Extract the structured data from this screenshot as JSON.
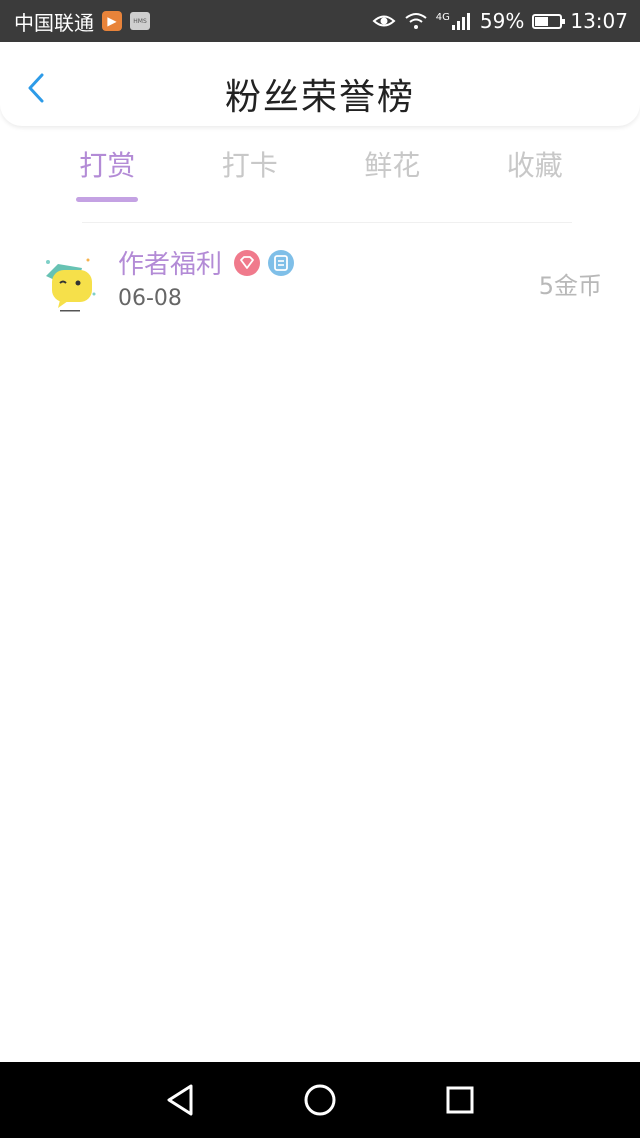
{
  "status_bar": {
    "carrier": "中国联通",
    "network": "4G",
    "battery_percent": "59%",
    "battery_level": 0.59,
    "time": "13:07",
    "icons": [
      "app-notification-icon",
      "hms-icon",
      "eye-icon",
      "wifi-icon",
      "signal-icon",
      "battery-icon"
    ]
  },
  "header": {
    "title": "粉丝荣誉榜",
    "back_icon": "chevron-left-icon"
  },
  "tabs": [
    {
      "label": "打赏",
      "active": true
    },
    {
      "label": "打卡",
      "active": false
    },
    {
      "label": "鲜花",
      "active": false
    },
    {
      "label": "收藏",
      "active": false
    }
  ],
  "list": [
    {
      "name": "作者福利",
      "date": "06-08",
      "amount": "5金币",
      "badges": [
        "heart-badge-icon",
        "doc-badge-icon"
      ],
      "avatar": "emoji-avatar-icon"
    }
  ],
  "colors": {
    "accent": "#b38bd6",
    "tab_inactive": "#c8c8c8",
    "back_arrow": "#2d9be8",
    "status_bar": "#3b3b3b",
    "nav_bar": "#000000"
  },
  "nav_bar": {
    "buttons": [
      "back-triangle-icon",
      "home-circle-icon",
      "recents-square-icon"
    ]
  }
}
